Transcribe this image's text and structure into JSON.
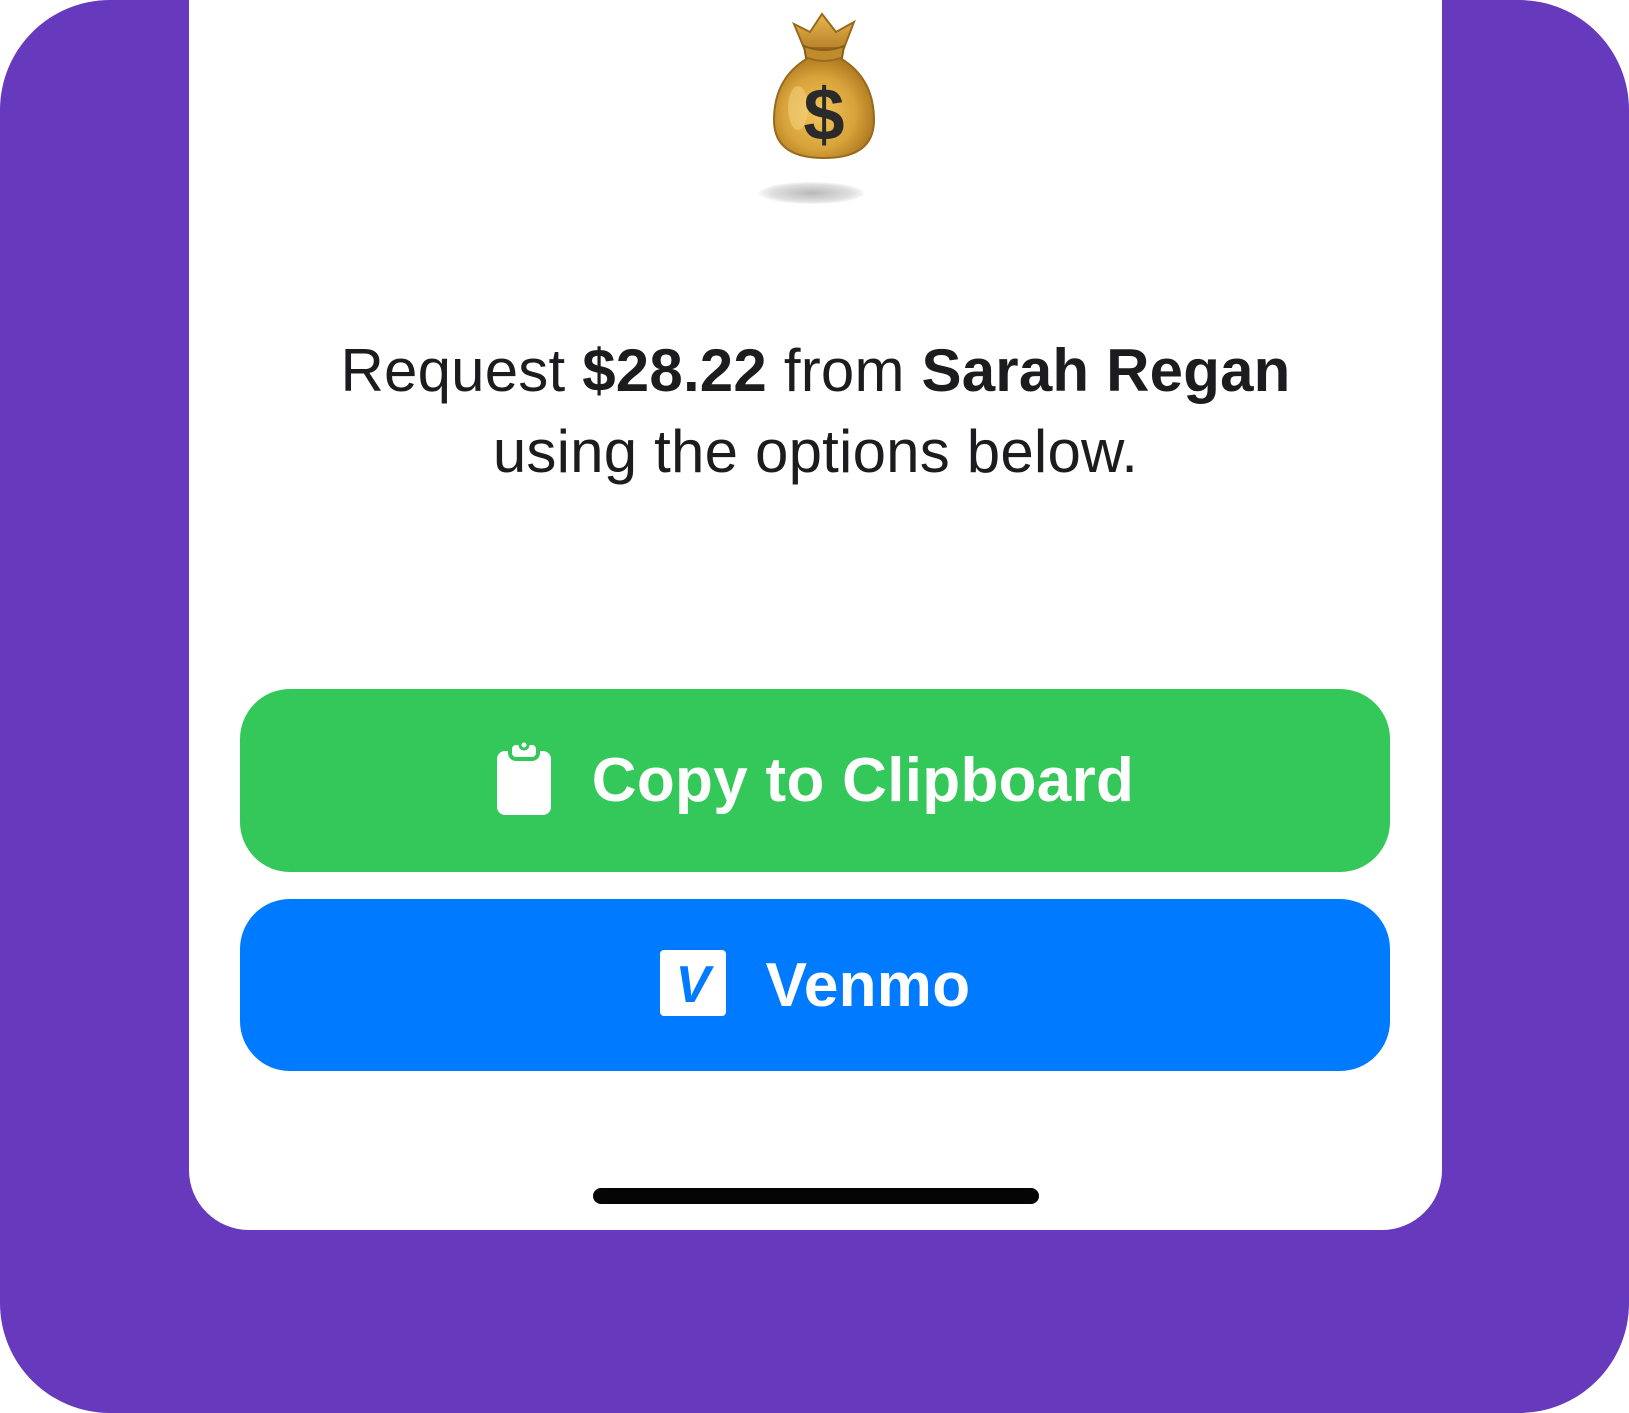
{
  "background_color": "#6639bd",
  "screen_color": "#ffffff",
  "emoji": {
    "icon": "money-bag-icon",
    "dollar_sign": "$"
  },
  "message": {
    "prefix": "Request ",
    "amount": "$28.22",
    "middle": " from ",
    "name": "Sarah Regan",
    "suffix": " using the options below."
  },
  "buttons": {
    "copy": {
      "label": "Copy to Clipboard",
      "icon": "clipboard-icon",
      "color": "#34c759"
    },
    "venmo": {
      "label": "Venmo",
      "icon": "venmo-icon",
      "icon_letter": "V",
      "color": "#007aff"
    }
  }
}
